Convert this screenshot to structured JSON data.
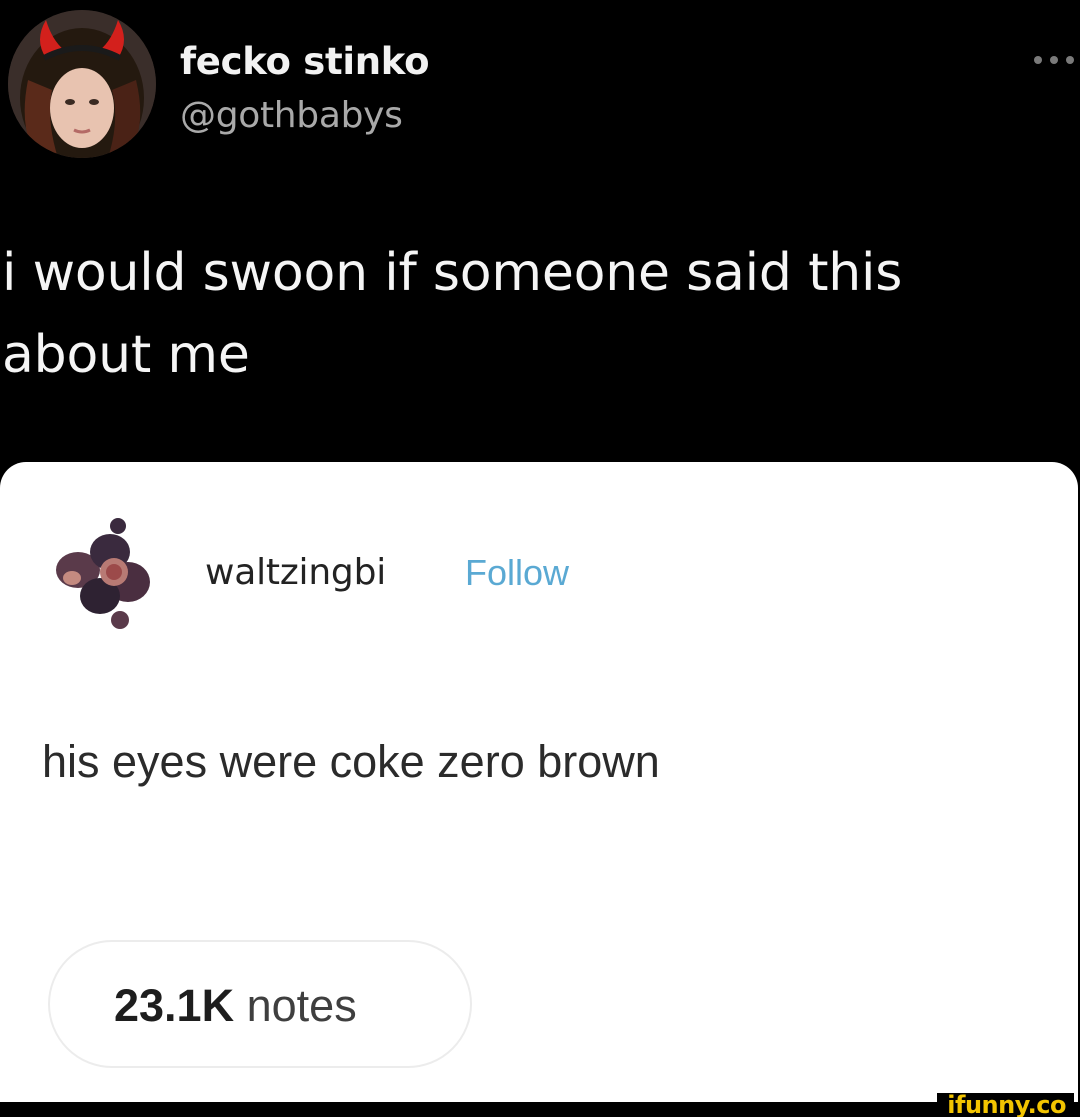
{
  "tweet": {
    "display_name": "fecko stinko",
    "handle": "@gothbabys",
    "avatar_icon": "profile-photo-with-red-devil-horns",
    "more_icon": "more-options-icon",
    "text_line1": "i would swoon if someone said this",
    "text_line2": "about me"
  },
  "embedded_post": {
    "username": "waltzingbi",
    "follow_label": "Follow",
    "avatar_icon": "figs-avatar",
    "body": "his eyes were coke zero brown",
    "notes_count": "23.1K",
    "notes_label": "notes"
  },
  "watermark": {
    "text": "ifunny.co"
  },
  "colors": {
    "background": "#000000",
    "card": "#ffffff",
    "follow_link": "#5aa9d3",
    "watermark": "#f2c400"
  }
}
